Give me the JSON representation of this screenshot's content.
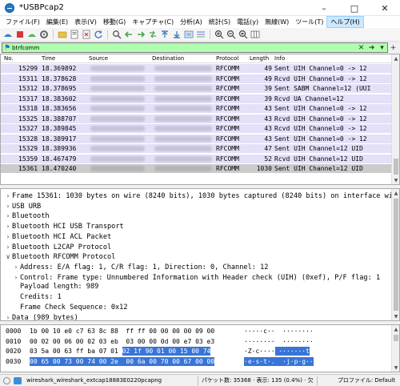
{
  "window": {
    "title": "*USBPcap2"
  },
  "menu": [
    "ファイル(F)",
    "編集(E)",
    "表示(V)",
    "移動(G)",
    "キャプチャ(C)",
    "分析(A)",
    "統計(S)",
    "電話(y)",
    "無線(W)",
    "ツール(T)",
    "ヘルプ(H)"
  ],
  "filter": {
    "value": "btrfcomm"
  },
  "packet_list": {
    "columns": [
      "No.",
      "Time",
      "Source",
      "Destination",
      "Protocol",
      "Length",
      "Info"
    ],
    "rows": [
      {
        "no": "15299",
        "time": "18.369892",
        "protocol": "RFCOMM",
        "length": "49",
        "info": "Sent UIH Channel=0 -> 12"
      },
      {
        "no": "15311",
        "time": "18.378628",
        "protocol": "RFCOMM",
        "length": "49",
        "info": "Rcvd UIH Channel=0 -> 12"
      },
      {
        "no": "15312",
        "time": "18.378695",
        "protocol": "RFCOMM",
        "length": "39",
        "info": "Sent SABM Channel=12 (UUI"
      },
      {
        "no": "15317",
        "time": "18.383602",
        "protocol": "RFCOMM",
        "length": "39",
        "info": "Rcvd UA Channel=12"
      },
      {
        "no": "15318",
        "time": "18.383656",
        "protocol": "RFCOMM",
        "length": "43",
        "info": "Sent UIH Channel=0 -> 12"
      },
      {
        "no": "15325",
        "time": "18.388707",
        "protocol": "RFCOMM",
        "length": "43",
        "info": "Rcvd UIH Channel=0 -> 12"
      },
      {
        "no": "15327",
        "time": "18.389845",
        "protocol": "RFCOMM",
        "length": "43",
        "info": "Rcvd UIH Channel=0 -> 12"
      },
      {
        "no": "15328",
        "time": "18.389917",
        "protocol": "RFCOMM",
        "length": "43",
        "info": "Sent UIH Channel=0 -> 12"
      },
      {
        "no": "15329",
        "time": "18.389936",
        "protocol": "RFCOMM",
        "length": "47",
        "info": "Sent UIH Channel=12 UID"
      },
      {
        "no": "15359",
        "time": "18.467479",
        "protocol": "RFCOMM",
        "length": "52",
        "info": "Rcvd UIH Channel=12 UID"
      },
      {
        "no": "15361",
        "time": "18.470240",
        "protocol": "RFCOMM",
        "length": "1030",
        "info": "Sent UIH Channel=12 UID"
      }
    ]
  },
  "details": [
    {
      "arrow": ">",
      "indent": 0,
      "text": "Frame 15361: 1030 bytes on wire (8240 bits), 1030 bytes captured (8240 bits) on interface wi"
    },
    {
      "arrow": ">",
      "indent": 0,
      "text": "USB URB"
    },
    {
      "arrow": ">",
      "indent": 0,
      "text": "Bluetooth"
    },
    {
      "arrow": ">",
      "indent": 0,
      "text": "Bluetooth HCI USB Transport"
    },
    {
      "arrow": ">",
      "indent": 0,
      "text": "Bluetooth HCI ACL Packet"
    },
    {
      "arrow": ">",
      "indent": 0,
      "text": "Bluetooth L2CAP Protocol"
    },
    {
      "arrow": "v",
      "indent": 0,
      "text": "Bluetooth RFCOMM Protocol"
    },
    {
      "arrow": ">",
      "indent": 1,
      "text": "Address: E/A flag: 1, C/R flag: 1, Direction: 0, Channel: 12"
    },
    {
      "arrow": ">",
      "indent": 1,
      "text": "Control: Frame type: Unnumbered Information with Header check (UIH) (0xef), P/F flag: 1"
    },
    {
      "arrow": "",
      "indent": 1,
      "text": "Payload length: 989"
    },
    {
      "arrow": "",
      "indent": 1,
      "text": "Credits: 1"
    },
    {
      "arrow": "",
      "indent": 1,
      "text": "Frame Check Sequence: 0x12"
    },
    {
      "arrow": ">",
      "indent": 0,
      "text": "Data (989 bytes)"
    }
  ],
  "bytes": [
    {
      "offset": "0000",
      "hex": "1b 00 10 e0 c7 63 8c 88  ff ff 00 00 00 00 09 00",
      "hex_hl": "",
      "ascii": "·····c··  ········",
      "ascii_hl": ""
    },
    {
      "offset": "0010",
      "hex": "00 02 00 06 00 02 03 eb  03 00 00 0d 00 e7 03 e3",
      "hex_hl": "",
      "ascii": "········  ········",
      "ascii_hl": ""
    },
    {
      "offset": "0020",
      "hex": "03 5a 00 63 ff ba 07 01 ",
      "hex_hl": "02 1f 90 01 00 15 00 74",
      "ascii": "·Z·c····",
      "ascii_hl": " ·······t"
    },
    {
      "offset": "0030",
      "hex": "",
      "hex_hl": "00 65 00 73 00 74 00 2e  00 6a 00 70 00 67 00 00",
      "ascii": "",
      "ascii_hl": "·e·s·t·.  ·j·p·g··"
    }
  ],
  "status": {
    "file": "wireshark_wireshark_extcap18883E0220pcapng",
    "stats": "パケット数: 35368 · 表示: 135 (0.4%) · 欠落: 0 (0.0%)",
    "profile": "プロファイル: Default"
  }
}
